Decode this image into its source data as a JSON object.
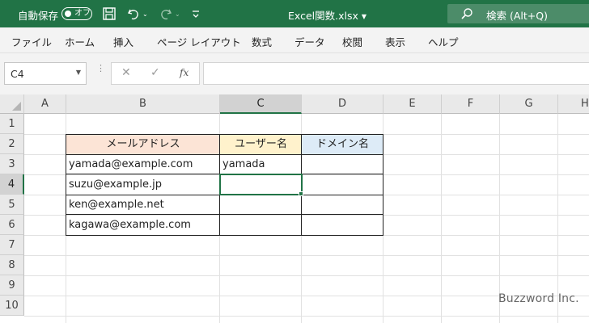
{
  "titlebar": {
    "autosave_label": "自動保存",
    "autosave_state": "オフ",
    "filename": "Excel関数.xlsx",
    "search_placeholder": "検索 (Alt+Q)"
  },
  "menu": [
    "ファイル",
    "ホーム",
    "挿入",
    "ページ レイアウト",
    "数式",
    "データ",
    "校閲",
    "表示",
    "ヘルプ"
  ],
  "formula_bar": {
    "name_box": "C4",
    "fx_label": "fx",
    "content": ""
  },
  "grid": {
    "columns": [
      "A",
      "B",
      "C",
      "D",
      "E",
      "F",
      "G",
      "H"
    ],
    "rows": [
      "1",
      "2",
      "3",
      "4",
      "5",
      "6",
      "7",
      "8",
      "9",
      "10"
    ],
    "selected_cell": "C4",
    "headers": {
      "B2": "メールアドレス",
      "C2": "ユーザー名",
      "D2": "ドメイン名"
    },
    "cells": {
      "B3": "yamada@example.com",
      "B4": "suzu@example.jp",
      "B5": "ken@example.net",
      "B6": "kagawa@example.com",
      "C3": "yamada"
    },
    "header_fill": {
      "B2": "#fce4d6",
      "C2": "#fff2cc",
      "D2": "#ddebf7"
    }
  },
  "watermark": "Buzzword Inc.",
  "colors": {
    "accent": "#217346"
  }
}
